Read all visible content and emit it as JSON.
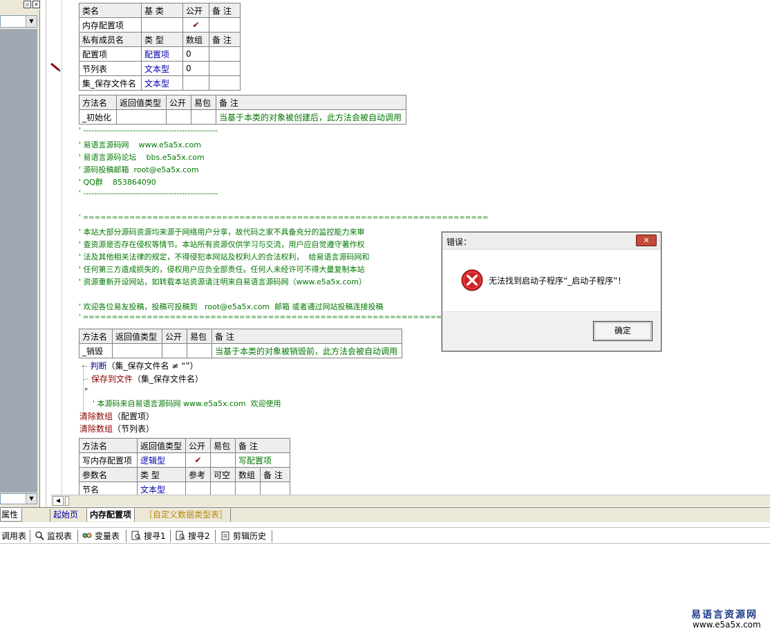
{
  "left_panel": {
    "restore_glyph": "▫",
    "close_glyph": "×",
    "combo_arrow": "▼",
    "bottom_arrow": "▼"
  },
  "class_table": {
    "header1": [
      "类名",
      "基 类",
      "公开",
      "备 注"
    ],
    "row1": [
      "内存配置项",
      "",
      "✔",
      ""
    ],
    "header2": [
      "私有成员名",
      "类 型",
      "数组",
      "备 注"
    ],
    "members": [
      [
        "配置项",
        "配置项",
        "0",
        ""
      ],
      [
        "节列表",
        "文本型",
        "0",
        ""
      ],
      [
        "集_保存文件名",
        "文本型",
        "",
        ""
      ]
    ]
  },
  "method_init": {
    "header": [
      "方法名",
      "返回值类型",
      "公开",
      "易包",
      "备 注"
    ],
    "row": [
      "_初始化",
      "",
      "",
      "",
      "当基于本类的对象被创建后，此方法会被自动调用"
    ]
  },
  "comments_block1": [
    "' -------------------------------------------------",
    "' 易语言源码网    www.e5a5x.com",
    "' 易语言源码论坛    bbs.e5a5x.com",
    "' 源码投稿邮箱  root@e5a5x.com",
    "' QQ群    853864090",
    "' -------------------------------------------------"
  ],
  "comments_block2": [
    "' ======================================================================",
    "' 本站大部分源码资源均来源于网络用户分享，故代码之家不具备充分的监控能力来审",
    "' 查资源是否存在侵权等情节。本站所有资源仅供学习与交流，用户应自觉遵守著作权",
    "' 法及其他相关法律的规定，不得侵犯本网站及权利人的合法权利，  给易语言源码网和",
    "' 任何第三方造成损失的，侵权用户应负全部责任。任何人未经许可不得大量复制本站",
    "' 资源重新开设网站，如转载本站资源请注明来自易语言源码网（www.e5a5x.com）",
    "",
    "' 欢迎各位易友投稿，投稿可投稿到   root@e5a5x.com  邮箱 或者通过网站投稿连接投稿",
    "' ======================================================================"
  ],
  "method_destroy": {
    "header": [
      "方法名",
      "返回值类型",
      "公开",
      "易包",
      "备 注"
    ],
    "row": [
      "_销毁",
      "",
      "",
      "",
      "当基于本类的对象被销毁前，此方法会被自动调用"
    ]
  },
  "code_lines": {
    "judge_kw": "判断",
    "judge_rest": "（集_保存文件名 ≠ “”）",
    "save_kw": "保存到文件",
    "save_rest": "（集_保存文件名）",
    "source_comment": "' 本源码来自易语言源码网 www.e5a5x.com  欢迎使用",
    "clear1_kw": "清除数组",
    "clear1_rest": "（配置项）",
    "clear2_kw": "清除数组",
    "clear2_rest": "（节列表）"
  },
  "method_write": {
    "header": [
      "方法名",
      "返回值类型",
      "公开",
      "易包",
      "备 注"
    ],
    "row": [
      "写内存配置项",
      "逻辑型",
      "✔",
      "",
      "写配置项"
    ],
    "param_header": [
      "参数名",
      "类 型",
      "参考",
      "可空",
      "数组",
      "备 注"
    ],
    "param_row": [
      "节名",
      "文本型",
      "",
      "",
      "",
      ""
    ]
  },
  "tabs": {
    "props": "属性",
    "start": "起始页",
    "memconf": "内存配置项",
    "custom": "［自定义数据类型表］"
  },
  "toolbar": {
    "items": [
      "调用表",
      "监视表",
      "变量表",
      "搜寻1",
      "搜寻2",
      "剪辑历史"
    ]
  },
  "dialog": {
    "title": "错误：",
    "close": "✕",
    "message": "无法找到启动子程序“_启动子程序”！",
    "ok": "确定"
  },
  "watermark": {
    "title": "易语言资源网",
    "url": "www.e5a5x.com"
  },
  "colors": {
    "comment_green": "#007700",
    "type_blue": "#0000aa",
    "keyword_red": "#8b0000",
    "dialog_close_red": "#c44a3a"
  }
}
